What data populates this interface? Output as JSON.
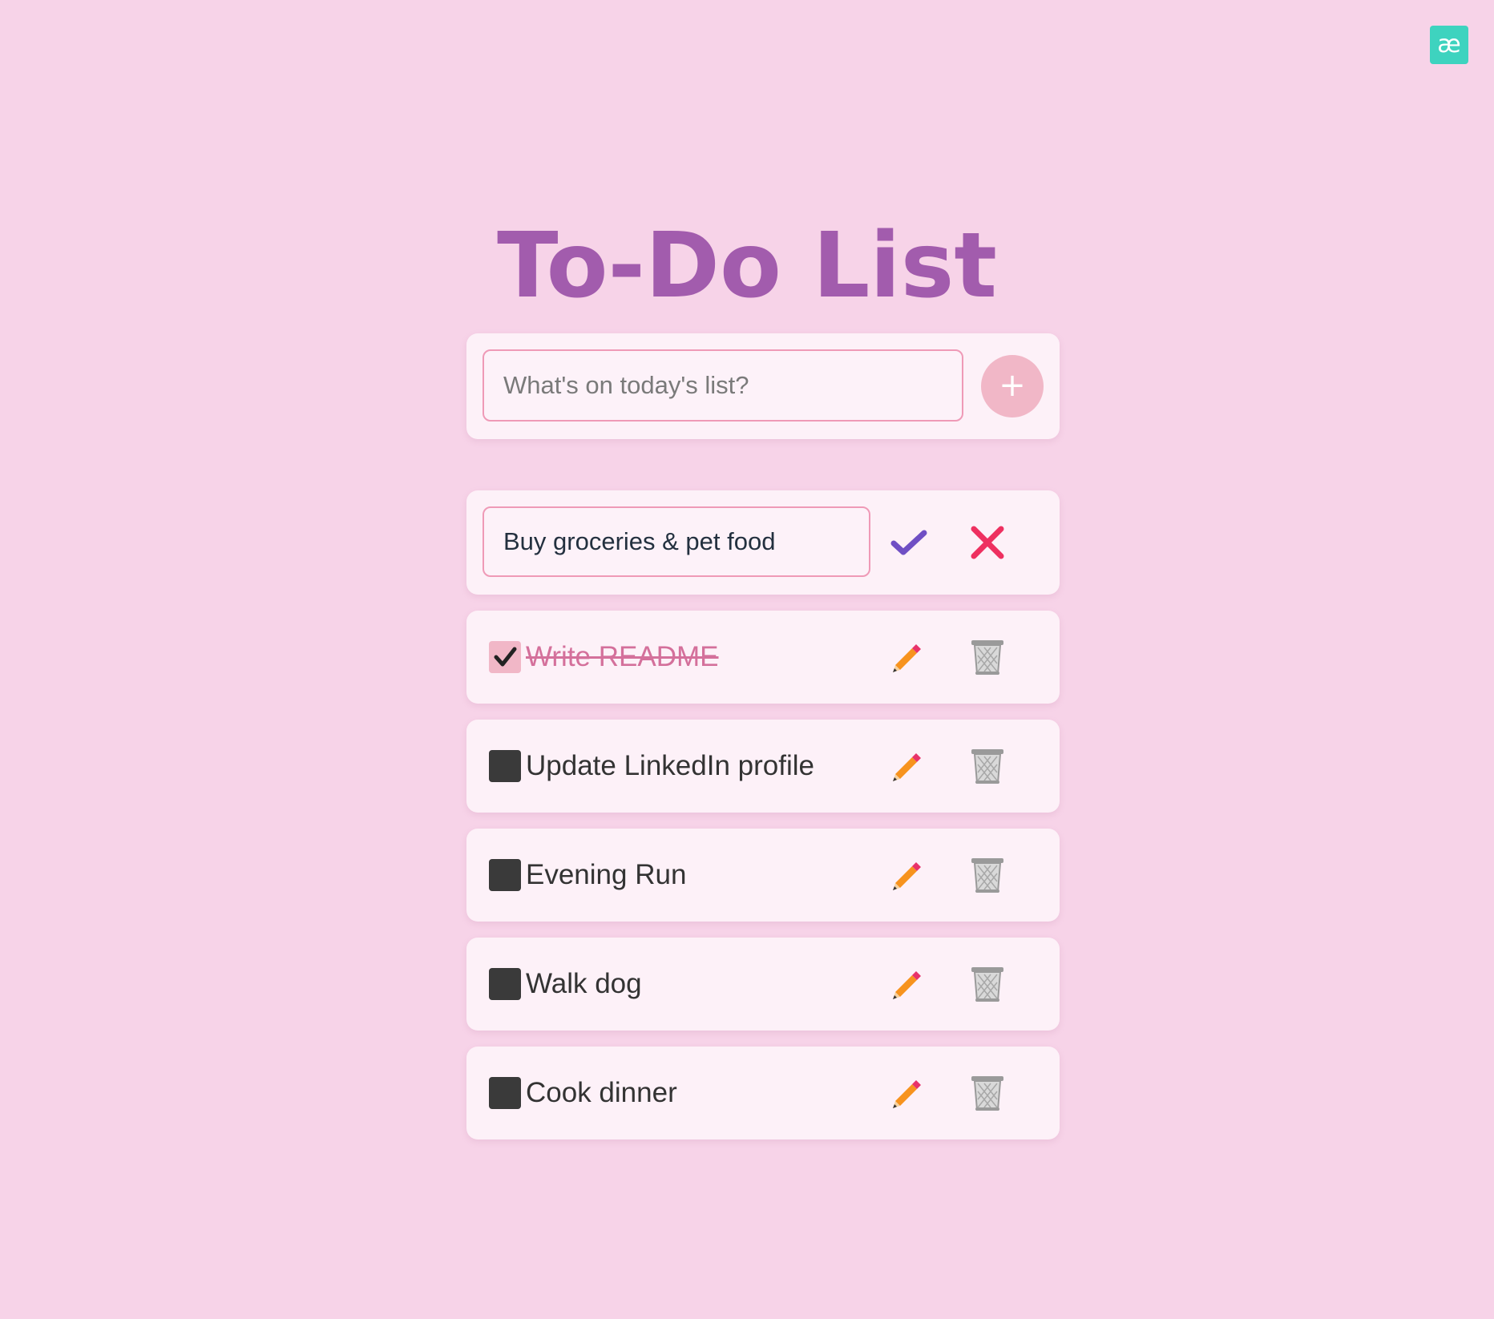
{
  "app": {
    "title": "To-Do List",
    "brand_badge": "æ"
  },
  "new_task": {
    "value": "",
    "placeholder": "What's on today's list?",
    "add_label": "+"
  },
  "editing_task": {
    "value": "Buy groceries & pet food",
    "confirm_icon": "check-icon",
    "cancel_icon": "close-icon"
  },
  "tasks": [
    {
      "text": "Write README",
      "completed": true
    },
    {
      "text": "Update LinkedIn profile",
      "completed": false
    },
    {
      "text": "Evening Run",
      "completed": false
    },
    {
      "text": "Walk dog",
      "completed": false
    },
    {
      "text": "Cook dinner",
      "completed": false
    }
  ],
  "icons": {
    "edit": "pencil-icon",
    "delete": "trash-icon"
  },
  "colors": {
    "background": "#f7d3e8",
    "card": "#fdf1f8",
    "title": "#a25cad",
    "accent_pink": "#f1b7c7",
    "input_border": "#ef9ab7",
    "confirm": "#6f4fc4",
    "cancel": "#ee3060",
    "completed_text": "#d4709b",
    "badge": "#3ed3bf"
  }
}
